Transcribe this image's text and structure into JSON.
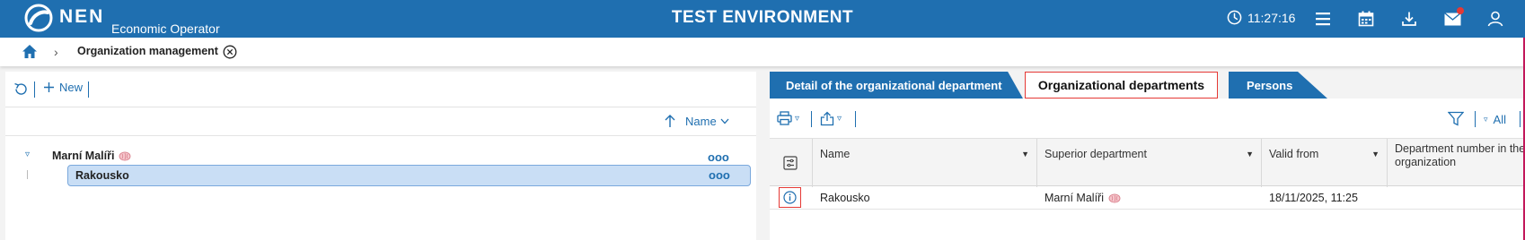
{
  "topbar": {
    "brand": "NEN",
    "brand_sub": "Economic Operator",
    "environment_title": "TEST ENVIRONMENT",
    "clock_time": "11:27:16",
    "bg_color": "#1f6fb0",
    "notification_color": "#e53935"
  },
  "breadcrumb": {
    "current": "Organization management"
  },
  "left_panel": {
    "new_label": "New",
    "sort_label": "Name",
    "tree": [
      {
        "label": "Marní Malíři",
        "expanded": true,
        "children": [
          {
            "label": "Rakousko",
            "selected": true
          }
        ]
      }
    ],
    "more_glyph": "ooo"
  },
  "tabs": {
    "detail": "Detail of the organizational department",
    "departments": "Organizational departments",
    "persons": "Persons",
    "active": "departments"
  },
  "right_panel": {
    "filter_all": "All",
    "columns": [
      "Name",
      "Superior department",
      "Valid from",
      "Department number in the organization"
    ],
    "rows": [
      {
        "name": "Rakousko",
        "superior": "Marní Malíři",
        "valid_from": "18/11/2025, 11:25",
        "dept_number": ""
      }
    ]
  }
}
